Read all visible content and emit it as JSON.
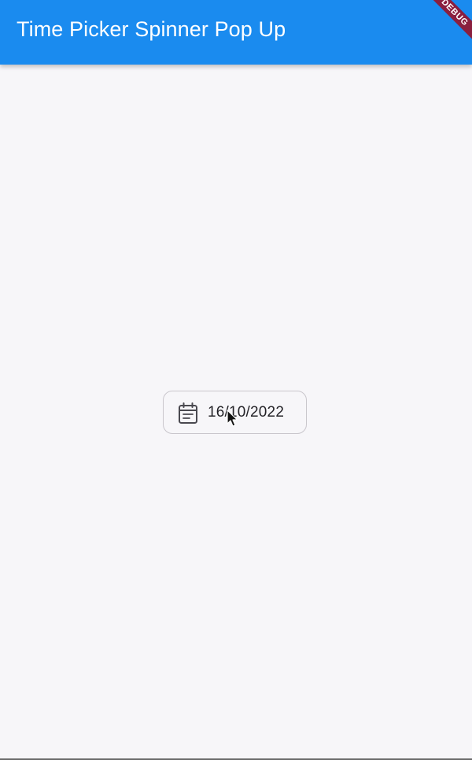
{
  "app_bar": {
    "title": "Time Picker Spinner Pop Up",
    "color": "#1a8bef"
  },
  "debug_banner": {
    "label": "DEBUG",
    "color": "#8a1f3f"
  },
  "date_button": {
    "icon": "calendar-icon",
    "value": "16/10/2022"
  }
}
